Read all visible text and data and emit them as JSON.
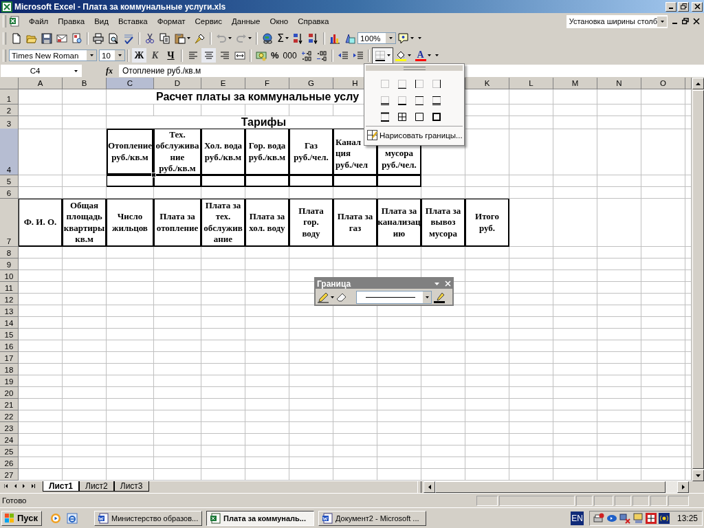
{
  "window": {
    "title": "Microsoft Excel - Плата за коммунальные услуги.xls"
  },
  "menu": {
    "items": [
      "Файл",
      "Правка",
      "Вид",
      "Вставка",
      "Формат",
      "Сервис",
      "Данные",
      "Окно",
      "Справка"
    ],
    "help_box": "Установка ширины столб"
  },
  "standard_toolbar": {
    "sum": "Σ",
    "zoom": "100%"
  },
  "formatting_toolbar": {
    "font": "Times New Roman",
    "size": "10",
    "styles": [
      {
        "label": "Ж",
        "selected": true
      },
      {
        "label": "К",
        "selected": false
      },
      {
        "label": "Ч",
        "selected": false
      }
    ],
    "alignment": [
      {
        "kind": "left",
        "selected": false
      },
      {
        "kind": "center",
        "selected": true
      },
      {
        "kind": "right",
        "selected": false
      }
    ],
    "percent": "%",
    "thousands": "000",
    "font_color": "A"
  },
  "formula_bar": {
    "name_box": "C4",
    "function_label": "fx",
    "value": "Отопление руб./кв.м"
  },
  "grid": {
    "columns": [
      {
        "label": "A",
        "selected": false
      },
      {
        "label": "B",
        "selected": false
      },
      {
        "label": "C",
        "selected": true
      },
      {
        "label": "D",
        "selected": false
      },
      {
        "label": "E",
        "selected": false
      },
      {
        "label": "F",
        "selected": false
      },
      {
        "label": "G",
        "selected": false
      },
      {
        "label": "H",
        "selected": false
      },
      {},
      {},
      {
        "label": "K",
        "selected": false
      },
      {
        "label": "L",
        "selected": false
      },
      {
        "label": "M",
        "selected": false
      },
      {
        "label": "N",
        "selected": false
      },
      {
        "label": "O",
        "selected": false
      }
    ],
    "rows": [
      {
        "number": "1",
        "kind": "title",
        "selected": false,
        "cells": [
          "Расчет платы за коммунальные услу"
        ]
      },
      {
        "number": "2",
        "kind": "plain",
        "selected": false
      },
      {
        "number": "3",
        "kind": "band",
        "selected": false,
        "cells": [
          "Тарифы"
        ]
      },
      {
        "number": "4",
        "kind": "tariffs",
        "selected": true,
        "cells": [
          "Отопление\nруб./кв.м",
          "Тех.\nобслужива\nние\nруб./кв.м",
          "Хол. вода\nруб./кв.м",
          "Гор. вода\nруб./кв.м",
          "Газ\nруб./чел.",
          "Канал\nция\nруб./чел",
          "мусора\nруб./чел."
        ]
      },
      {
        "number": "5",
        "kind": "entry",
        "selected": false
      },
      {
        "number": "6",
        "kind": "plain",
        "selected": false
      },
      {
        "number": "7",
        "kind": "fees",
        "selected": false,
        "cells": [
          "Ф. И. О.",
          "Общая\nплощадь\nквартиры\nкв.м",
          "Число\nжильцов",
          "Плата за\nотопление",
          "Плата за\nтех.\nобслужив\nание",
          "Плата за\nхол. воду",
          "Плата гор.\nводу",
          "Плата за\nгаз",
          "Плата за\nканализац\nию",
          "Плата за\nвывоз\nмусора",
          "Итого руб."
        ]
      },
      {
        "number": "8",
        "kind": "plain",
        "selected": false
      },
      {
        "number": "9",
        "kind": "plain",
        "selected": false
      },
      {
        "number": "10",
        "kind": "plain",
        "selected": false
      },
      {
        "number": "11",
        "kind": "plain",
        "selected": false
      },
      {
        "number": "12",
        "kind": "plain",
        "selected": false
      },
      {
        "number": "13",
        "kind": "plain",
        "selected": false
      },
      {
        "number": "14",
        "kind": "plain",
        "selected": false
      },
      {
        "number": "15",
        "kind": "plain",
        "selected": false
      },
      {
        "number": "16",
        "kind": "plain",
        "selected": false
      },
      {
        "number": "17",
        "kind": "plain",
        "selected": false
      },
      {
        "number": "18",
        "kind": "plain",
        "selected": false
      },
      {
        "number": "19",
        "kind": "plain",
        "selected": false
      },
      {
        "number": "20",
        "kind": "plain",
        "selected": false
      },
      {
        "number": "21",
        "kind": "plain",
        "selected": false
      },
      {
        "number": "22",
        "kind": "plain",
        "selected": false
      },
      {
        "number": "23",
        "kind": "plain",
        "selected": false
      },
      {
        "number": "24",
        "kind": "plain",
        "selected": false
      },
      {
        "number": "25",
        "kind": "plain",
        "selected": false
      },
      {
        "number": "26",
        "kind": "plain",
        "selected": false
      },
      {
        "number": "27",
        "kind": "plain",
        "selected": false
      }
    ]
  },
  "borders_menu": {
    "draw_item": "Нарисовать границы..."
  },
  "border_toolbar": {
    "title": "Граница"
  },
  "sheets": [
    {
      "label": "Лист1",
      "selected": true
    },
    {
      "label": "Лист2",
      "selected": false
    },
    {
      "label": "Лист3",
      "selected": false
    }
  ],
  "status_bar": {
    "text": "Готово"
  },
  "taskbar": {
    "start": "Пуск",
    "tasks": [
      {
        "label": "Министерство образов...",
        "kind": "word",
        "selected": false
      },
      {
        "label": "Плата за коммуналь...",
        "kind": "excel",
        "selected": true
      },
      {
        "label": "Документ2 - Microsoft ...",
        "kind": "word",
        "selected": false
      }
    ],
    "language": "EN",
    "clock": "13:25"
  }
}
